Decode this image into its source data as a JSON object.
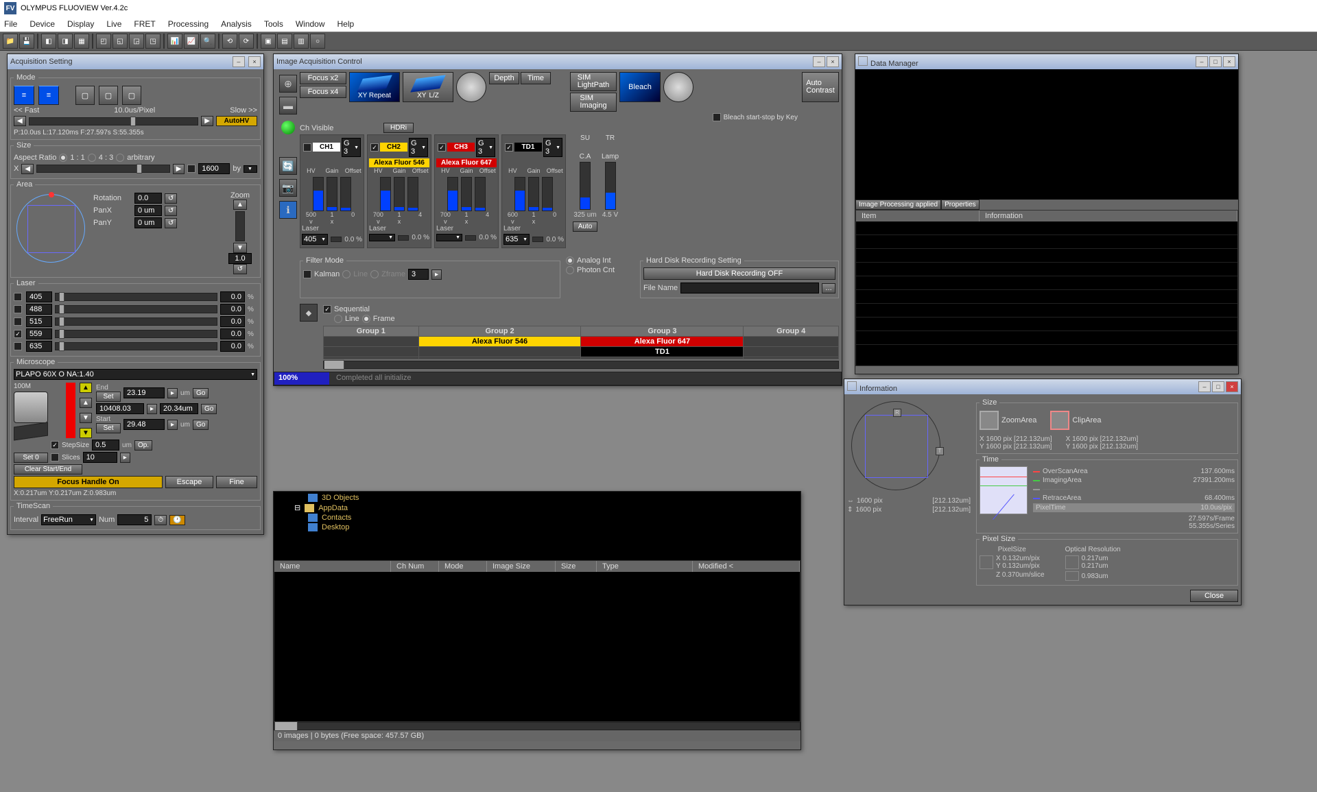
{
  "app_title": "OLYMPUS FLUOVIEW Ver.4.2c",
  "menus": [
    "File",
    "Device",
    "Display",
    "Live",
    "FRET",
    "Processing",
    "Analysis",
    "Tools",
    "Window",
    "Help"
  ],
  "acq": {
    "title": "Acquisition Setting",
    "mode": {
      "fast": "<< Fast",
      "slow": "Slow >>",
      "pixel_time": "10.0us/Pixel",
      "autohv": "AutoHV",
      "stats": "P:10.0us   L:17.120ms   F:27.597s   S:55.355s"
    },
    "size": {
      "legend": "Size",
      "aspect": "Aspect Ratio",
      "r11": "1 : 1",
      "r43": "4 : 3",
      "rarb": "arbitrary",
      "x": "X",
      "val": "1600",
      "by": "by"
    },
    "area": {
      "legend": "Area",
      "rotation": "Rotation",
      "rot_val": "0.0",
      "panx": "PanX",
      "panx_val": "0 um",
      "pany": "PanY",
      "pany_val": "0 um",
      "zoom": "Zoom",
      "zoom_val": "1.0"
    },
    "laser": {
      "legend": "Laser",
      "rows": [
        {
          "nm": "405",
          "pct": "0.0"
        },
        {
          "nm": "488",
          "pct": "0.0"
        },
        {
          "nm": "515",
          "pct": "0.0"
        },
        {
          "nm": "559",
          "pct": "0.0"
        },
        {
          "nm": "635",
          "pct": "0.0"
        }
      ],
      "unit": "%"
    },
    "microscope": {
      "legend": "Microscope",
      "objective": "PLAPO   60X O  NA:1.40",
      "focus": "100M",
      "end": "End",
      "set1": "Set",
      "end_val": "23.19",
      "um": "um",
      "go": "Go",
      "mid_val": "10408.03",
      "mid_step": "20.34um",
      "start": "Start",
      "set2": "Set",
      "start_val": "29.48",
      "stepsize": "StepSize",
      "step_val": "0.5",
      "op": "Op.",
      "set0": "Set 0",
      "slices": "Slices",
      "slices_val": "10",
      "clear": "Clear Start/End",
      "focuson": "Focus Handle On",
      "escape": "Escape",
      "fine": "Fine",
      "coords": "X:0.217um Y:0.217um Z:0.983um"
    },
    "timescan": {
      "legend": "TimeScan",
      "interval": "Interval",
      "freerun": "FreeRun",
      "num": "Num",
      "num_val": "5"
    }
  },
  "iac": {
    "title": "Image Acquisition Control",
    "focus2": "Focus x2",
    "focus4": "Focus x4",
    "xyrepeat": "XY Repeat",
    "xy": "XY",
    "lz": "L/Z",
    "depth": "Depth",
    "time": "Time",
    "sim_lp": "SIM\nLightPath",
    "sim_img": "SIM\nImaging",
    "bleach": "Bleach",
    "autoc": "Auto\nContrast",
    "bleach_key": "Bleach start-stop by Key",
    "chvis": "Ch Visible",
    "hdri": "HDRi",
    "channels": [
      {
        "id": "CH1",
        "g": "G 3",
        "fluor": "",
        "fluor_bg": "#555",
        "vals": [
          "500",
          "1",
          "0"
        ],
        "laser": "Laser",
        "nm": "405",
        "pct": "0.0 %"
      },
      {
        "id": "CH2",
        "g": "G 3",
        "fluor": "Alexa Fluor 546",
        "fluor_bg": "#ffd400",
        "fluor_color": "#000",
        "vals": [
          "700",
          "1",
          "4"
        ],
        "nm": "",
        "pct": "0.0 %"
      },
      {
        "id": "CH3",
        "g": "G 3",
        "fluor": "Alexa Fluor 647",
        "fluor_bg": "#d00000",
        "fluor_color": "#fff",
        "vals": [
          "700",
          "1",
          "4"
        ],
        "nm": "",
        "pct": "0.0 %"
      },
      {
        "id": "TD1",
        "g": "G 3",
        "fluor": "",
        "fluor_bg": "#555",
        "vals": [
          "600",
          "1",
          "0"
        ],
        "nm": "635",
        "pct": "0.0 %"
      }
    ],
    "hv_gain_offset": [
      "HV",
      "Gain",
      "Offset"
    ],
    "su": "SU",
    "tr": "TR",
    "ca": "C.A",
    "ca_val": "325 um",
    "lamp": "Lamp",
    "lamp_val": "4.5 V",
    "auto": "Auto",
    "filter": {
      "legend": "Filter Mode",
      "kalman": "Kalman",
      "line": "Line",
      "zframe": "Zframe",
      "framesval": "3",
      "analog": "Analog Int",
      "photon": "Photon Cnt"
    },
    "hdrs": {
      "legend": "Hard Disk Recording Setting",
      "off": "Hard Disk Recording OFF",
      "filename": "File Name"
    },
    "seq": "Sequential",
    "line": "Line",
    "frame": "Frame",
    "groups": [
      "Group 1",
      "Group 2",
      "Group 3",
      "Group 4"
    ],
    "grouprows": [
      [
        "",
        "Alexa Fluor 546",
        "Alexa Fluor 647",
        ""
      ],
      [
        "",
        "",
        "TD1",
        ""
      ]
    ],
    "prog_pct": "100%",
    "prog_msg": "Completed all initialize"
  },
  "browser": {
    "tree": [
      "3D Objects",
      "AppData",
      "Contacts",
      "Desktop"
    ],
    "cols": [
      "Name",
      "Ch Num",
      "Mode",
      "Image Size",
      "Size",
      "Type",
      "Modified <"
    ],
    "status": "0 images    |   0 bytes (Free space: 457.57 GB)"
  },
  "dm": {
    "title": "Data Manager",
    "imgproc": "Image Processing applied",
    "props": "Properties",
    "col1": "Item",
    "col2": "Information"
  },
  "info": {
    "title": "Information",
    "sz_legend": "Size",
    "zoom": "ZoomArea",
    "clip": "ClipArea",
    "x": "X  1600 pix  [212.132um]",
    "y": "Y  1600 pix  [212.132um]",
    "x2": "X 1600 pix [212.132um]",
    "y2": "Y 1600 pix [212.132um]",
    "dim_x": "1600 pix",
    "dim_um": "[212.132um]",
    "time_legend": "Time",
    "overscan": "OverScanArea",
    "overscan_v": "137.600ms",
    "imaging": "ImagingArea",
    "imaging_v": "27391.200ms",
    "retrace": "RetraceArea",
    "retrace_v": "68.400ms",
    "pixeltime": "PixelTime",
    "pixeltime_v": "10.0us/pix",
    "frame": "27.597s/Frame",
    "series": "55.355s/Series",
    "ps_legend": "Pixel Size",
    "ps": "PixelSize",
    "opt": "Optical Resolution",
    "psx": "X  0.132um/pix",
    "psy": "Y  0.132um/pix",
    "psz": "Z  0.370um/slice",
    "optx": "0.217um",
    "opty": "0.217um",
    "optz": "0.983um",
    "close": "Close"
  }
}
